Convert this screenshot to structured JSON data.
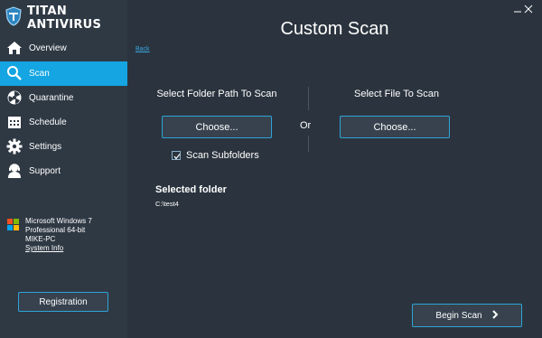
{
  "app": {
    "title": "TITAN ANTIVIRUS"
  },
  "sidebar": {
    "items": [
      {
        "label": "Overview",
        "icon": "home-icon",
        "active": false
      },
      {
        "label": "Scan",
        "icon": "search-icon",
        "active": true
      },
      {
        "label": "Quarantine",
        "icon": "biohazard-icon",
        "active": false
      },
      {
        "label": "Schedule",
        "icon": "calendar-icon",
        "active": false
      },
      {
        "label": "Settings",
        "icon": "gear-icon",
        "active": false
      },
      {
        "label": "Support",
        "icon": "support-agent-icon",
        "active": false
      }
    ],
    "system": {
      "os_line1": "Microsoft Windows 7",
      "os_line2": "Professional  64-bit",
      "computer": "MIKE-PC",
      "link": "System Info"
    },
    "registration_label": "Registration"
  },
  "main": {
    "title": "Custom Scan",
    "back_label": "Back",
    "folder_heading": "Select Folder Path To Scan",
    "file_heading": "Select File To Scan",
    "choose_folder_label": "Choose...",
    "choose_file_label": "Choose...",
    "or_label": "Or",
    "subfolders_label": "Scan Subfolders",
    "subfolders_checked": true,
    "selected_title": "Selected folder",
    "selected_path": "C:\\test4",
    "begin_label": "Begin Scan"
  },
  "colors": {
    "accent": "#14a5e2",
    "sidebar_bg": "#2f3944",
    "main_bg": "#2b343e",
    "button_border": "#2ea4d8"
  }
}
